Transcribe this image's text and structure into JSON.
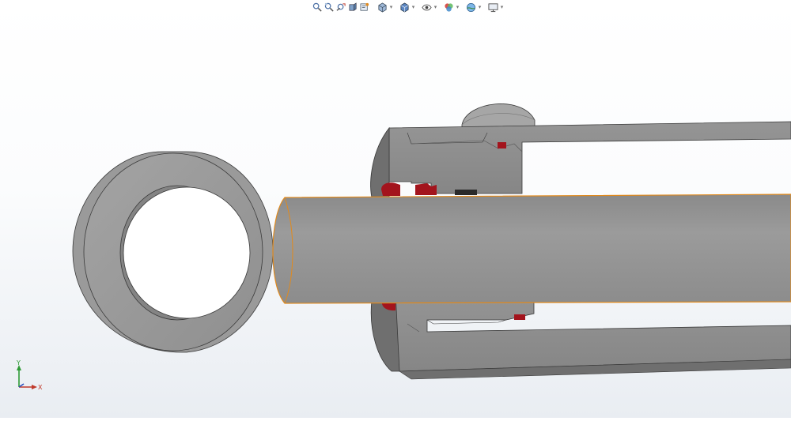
{
  "toolbar": {
    "items": [
      {
        "icon": "zoom-to-fit-icon",
        "has_dropdown": false
      },
      {
        "icon": "zoom-to-area-icon",
        "has_dropdown": false
      },
      {
        "icon": "previous-view-icon",
        "has_dropdown": false
      },
      {
        "icon": "section-view-icon",
        "has_dropdown": false
      },
      {
        "icon": "dynamic-annotation-icon",
        "has_dropdown": false
      },
      {
        "icon": "view-orientation-icon",
        "has_dropdown": true
      },
      {
        "icon": "display-style-icon",
        "has_dropdown": true
      },
      {
        "icon": "hide-show-items-icon",
        "has_dropdown": true
      },
      {
        "icon": "edit-appearance-icon",
        "has_dropdown": true
      },
      {
        "icon": "apply-scene-icon",
        "has_dropdown": true
      },
      {
        "icon": "view-settings-icon",
        "has_dropdown": true
      }
    ],
    "dropdown_glyph": "▾"
  },
  "triad": {
    "y_label": "Y",
    "x_label": "X",
    "colors": {
      "y": "#2e9a35",
      "x": "#c0392b",
      "z": "#2a4fbf"
    }
  },
  "model": {
    "colors": {
      "body": "#8c8c8c",
      "body_dark": "#6f6f6f",
      "body_light": "#a6a6a6",
      "ring_face": "#9a9a9a",
      "ring_bore": "#848484",
      "seal_red": "#a3141d",
      "seal_black": "#2a2a2a",
      "selection_outline": "#e08a1e",
      "edge": "#3a3a3a"
    }
  }
}
